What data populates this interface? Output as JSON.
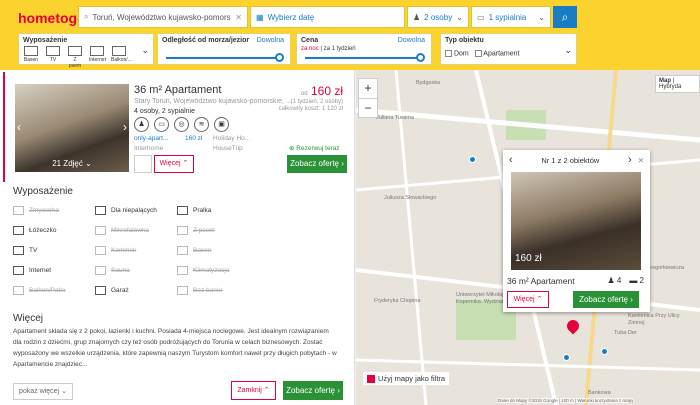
{
  "header": {
    "logo": "hometogo",
    "location": "Toruń, Województwo kujawsko-pomors",
    "date_placeholder": "Wybierz datę",
    "guests": "2 osoby",
    "bedrooms": "1 sypialnia"
  },
  "filters": {
    "amenities_title": "Wyposażenie",
    "amenities": [
      "Basen",
      "TV",
      "Z psem",
      "Internet",
      "Balkon/..."
    ],
    "distance_title": "Odległość od morza/jezior",
    "distance_value": "Dowolna",
    "price_title": "Cena",
    "price_value": "Dowolna",
    "price_unit_a": "za noc",
    "price_unit_b": "za 1 tydzień",
    "type_title": "Typ obiektu",
    "type_options": [
      "Dom",
      "Apartament"
    ]
  },
  "listing": {
    "title": "36 m² Apartament",
    "subtitle": "Stary Toruń, Województwo kujawsko-pomorskie, ...",
    "persons": "4 osoby, 2 sypialnie",
    "price_prefix": "od",
    "price": "160 zł",
    "price_note_1": "(1 tydzień, 2 osoby)",
    "price_note_2": "całkowity koszt: 1 120 zł",
    "photo_count": "21 Zdjęć",
    "provider_1": "only-apart...",
    "provider_1_price": "160 zł",
    "provider_2": "Interhome",
    "provider_3": "Holiday Ho...",
    "provider_4": "HouseTrip",
    "book_now": "Rezerwuj teraz",
    "more_button": "Więcej",
    "offer_button": "Zobacz ofertę"
  },
  "amenities_section": {
    "title": "Wyposażenie",
    "items": [
      {
        "label": "Zmywarka",
        "on": false
      },
      {
        "label": "Dla niepalących",
        "on": true
      },
      {
        "label": "Pralka",
        "on": true
      },
      {
        "label": "Łóżeczko",
        "on": true
      },
      {
        "label": "Mikrofalówka",
        "on": false
      },
      {
        "label": "Z psem",
        "on": false
      },
      {
        "label": "TV",
        "on": true
      },
      {
        "label": "Kominek",
        "on": false
      },
      {
        "label": "Basen",
        "on": false
      },
      {
        "label": "Internet",
        "on": true
      },
      {
        "label": "Sauna",
        "on": false
      },
      {
        "label": "Klimatyzacja",
        "on": false
      },
      {
        "label": "Balkon/Patio",
        "on": false
      },
      {
        "label": "Garaż",
        "on": true
      },
      {
        "label": "Bez barier",
        "on": false
      }
    ]
  },
  "description": {
    "title": "Więcej",
    "text": "Apartament składa się z 2 pokoi, łazienki i kuchni. Posiada 4-miejsca noclegowe. Jest idealnym rozwiązaniem dla rodzin z dziećmi, grup znajomych czy też osób podróżujących do Torunia w celach biznesowych. Zostać wyposażony we wszelkie urządzenia, które zapewnią naszym Turystom komfort nawet przy długich pobytach - w Apartamencie znajdziec...",
    "show_more": "pokaż więcej",
    "close": "Zamknij",
    "offer_button": "Zobacz ofertę"
  },
  "map": {
    "type_map": "Map",
    "type_hybrid": "Hybryda",
    "popup_nav": "Nr 1 z 2 obiektów",
    "popup_price": "160 zł",
    "popup_title": "36 m² Apartament",
    "popup_persons": "4",
    "popup_bedrooms": "2",
    "popup_more": "Więcej",
    "popup_offer": "Zobacz ofertę",
    "use_map_label": "Użyj mapy jako filtra",
    "attribution": "Dane do Mapy ©2015 Google | 100 m | Warunki korzystania z mapy",
    "streets": [
      "Juliana Tuwima",
      "Juliusza Słowackiego",
      "Fryderyka Chopina",
      "Uniwersytet Mikołaja Kopernika. Wydział...",
      "Bankowa",
      "Tuba Der",
      "Kamienica Przy Ulicy Zimnej",
      "Bydgoska",
      "Gregorkiewicza"
    ]
  }
}
